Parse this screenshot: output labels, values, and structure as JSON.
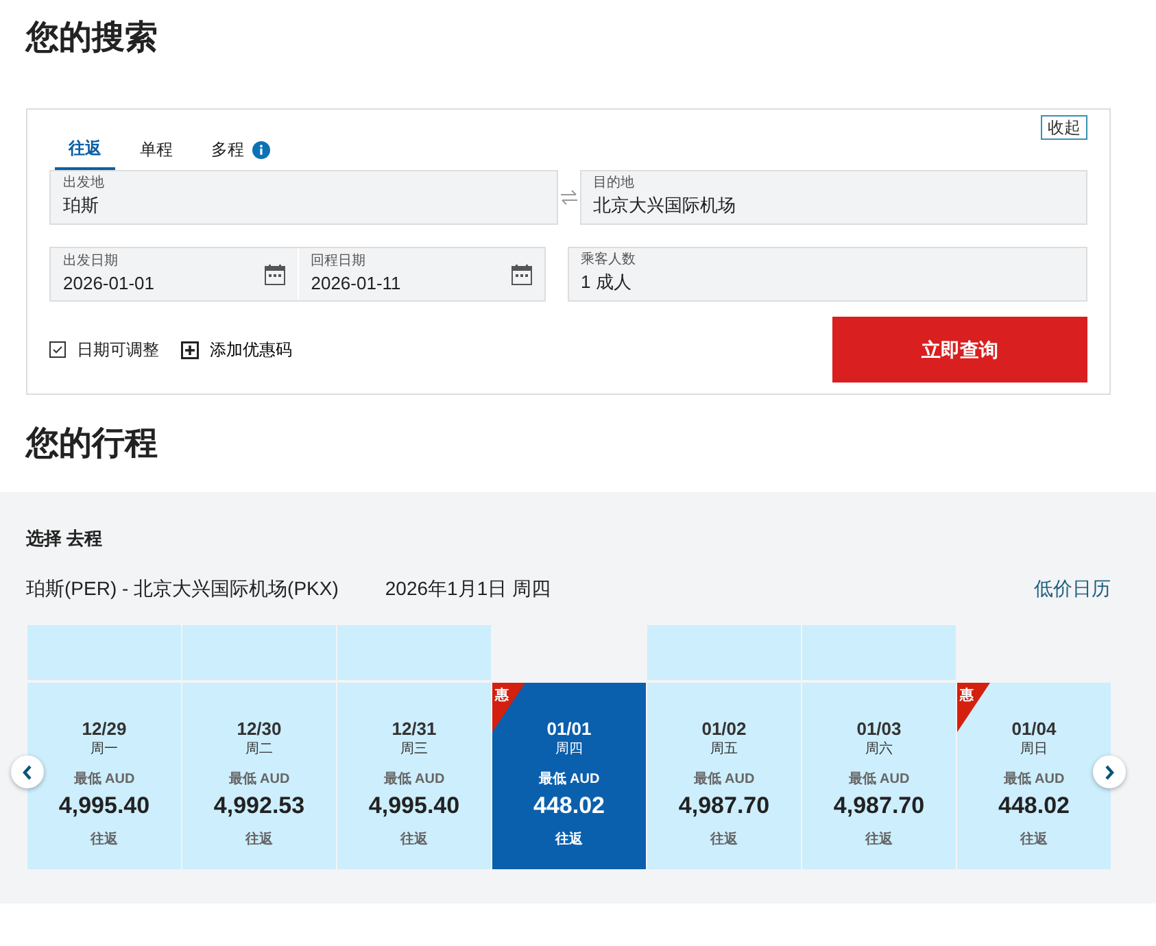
{
  "search_title": "您的搜索",
  "search_form": {
    "collapse_label": "收起",
    "tabs": [
      {
        "label": "往返",
        "selected": true,
        "info": false
      },
      {
        "label": "单程",
        "selected": false,
        "info": false
      },
      {
        "label": "多程",
        "selected": false,
        "info": true
      }
    ],
    "origin": {
      "label": "出发地",
      "value": "珀斯"
    },
    "destination": {
      "label": "目的地",
      "value": "北京大兴国际机场"
    },
    "depart_date": {
      "label": "出发日期",
      "value": "2026-01-01"
    },
    "return_date": {
      "label": "回程日期",
      "value": "2026-01-11"
    },
    "passengers": {
      "label": "乘客人数",
      "value": "1 成人"
    },
    "flexible_dates": {
      "label": "日期可调整",
      "checked": true
    },
    "promo_code": {
      "label": "添加优惠码"
    },
    "search_button": "立即查询"
  },
  "itinerary_title": "您的行程",
  "itinerary": {
    "heading": "选择 去程",
    "route": "珀斯(PER) - 北京大兴国际机场(PKX)",
    "date": "2026年1月1日 周四",
    "calendar_link": "低价日历",
    "days": [
      {
        "date": "12/29",
        "weekday": "周一",
        "price_label": "最低 AUD",
        "price": "4,995.40",
        "trip": "往返",
        "selected": false,
        "bar": true
      },
      {
        "date": "12/30",
        "weekday": "周二",
        "price_label": "最低 AUD",
        "price": "4,992.53",
        "trip": "往返",
        "selected": false,
        "bar": true
      },
      {
        "date": "12/31",
        "weekday": "周三",
        "price_label": "最低 AUD",
        "price": "4,995.40",
        "trip": "往返",
        "selected": false,
        "bar": true
      },
      {
        "date": "01/01",
        "weekday": "周四",
        "price_label": "最低 AUD",
        "price": "448.02",
        "trip": "往返",
        "selected": true,
        "deal": "惠",
        "bar": false
      },
      {
        "date": "01/02",
        "weekday": "周五",
        "price_label": "最低 AUD",
        "price": "4,987.70",
        "trip": "往返",
        "selected": false,
        "bar": true
      },
      {
        "date": "01/03",
        "weekday": "周六",
        "price_label": "最低 AUD",
        "price": "4,987.70",
        "trip": "往返",
        "selected": false,
        "bar": true
      },
      {
        "date": "01/04",
        "weekday": "周日",
        "price_label": "最低 AUD",
        "price": "448.02",
        "trip": "往返",
        "selected": false,
        "deal": "惠",
        "bar": false
      }
    ]
  }
}
